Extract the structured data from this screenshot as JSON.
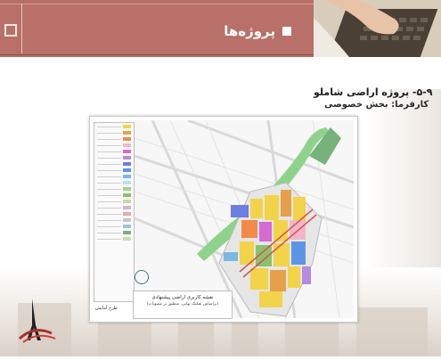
{
  "header": {
    "title": "پروژه‌ها"
  },
  "section": {
    "title": "۵-۹- پروژه اراضی شاملو",
    "subtitle": "کارفرما: بخش خصوصی"
  },
  "map": {
    "title": "نقشه کاربری اراضی پیشنهادی",
    "subtitle": "(براساس تفکیک نهایی، منطبق بر مصوبات)",
    "footer_label": "طرح آمایش"
  },
  "legend_colors": [
    "#f2d34a",
    "#e6a04b",
    "#f28a4a",
    "#f3b6c8",
    "#d46ad2",
    "#b48be0",
    "#6d7de0",
    "#5c95e8",
    "#7ab8e4",
    "#bcdcf2",
    "#a8d08d",
    "#89c26b",
    "#c7d99e",
    "#d1b3d6",
    "#e9a8a8",
    "#c5c5c5",
    "#9ec7c9",
    "#76b27a",
    "#c4e0a8"
  ],
  "colors": {
    "header": "#b56f68",
    "accent": "#a8302a"
  }
}
